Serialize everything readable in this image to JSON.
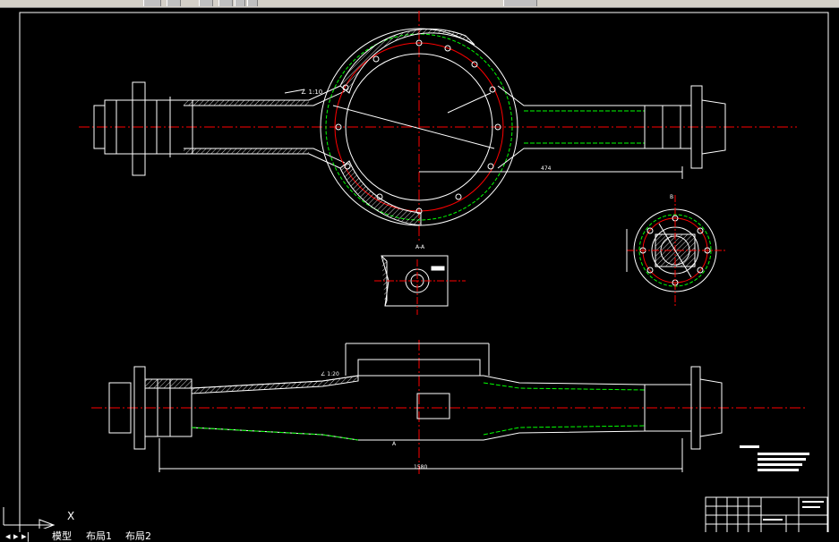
{
  "toolbar": {
    "buttons": [
      "layer-button",
      "properties-button",
      "zoom-button",
      "pan-button",
      "undo-button",
      "redo-button",
      "match-button"
    ]
  },
  "drawing": {
    "dimensions": {
      "top_angle": "∠ 1:10",
      "bottom_angle": "∠ 1:20",
      "top_length": "474",
      "bottom_length": "1580",
      "section_label": "A-A",
      "flange_view_label": "B",
      "label_a": "A"
    },
    "colors": {
      "outline": "#ffffff",
      "hidden": "#00ff00",
      "center": "#ff0000",
      "hatch": "#ffffff",
      "note_fill": "#ffffff"
    }
  },
  "ucs": {
    "x_label": "X"
  },
  "tabs": {
    "model": "模型",
    "layout1": "布局1",
    "layout2": "布局2"
  }
}
